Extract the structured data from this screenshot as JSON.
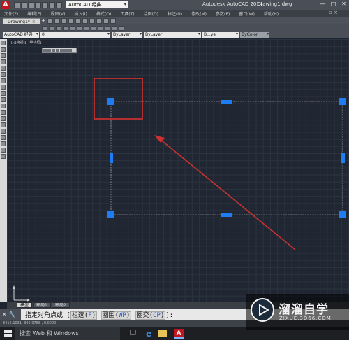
{
  "window": {
    "app_title": "Autodesk AutoCAD 2014",
    "document_title": "Drawing1.dwg",
    "workspace": "AutoCAD 经典",
    "controls": [
      "—",
      "□",
      "✕"
    ]
  },
  "menu": {
    "items": [
      "文件(F)",
      "编辑(E)",
      "视图(V)",
      "插入(I)",
      "格式(O)",
      "工具(T)",
      "绘图(D)",
      "标注(N)",
      "修改(M)",
      "参数(P)",
      "窗口(W)",
      "帮助(H)"
    ],
    "doc_controls": "_ ▫ ×"
  },
  "tabs": {
    "document": "Drawing1*",
    "close": "×",
    "add": "+"
  },
  "properties_toolbar": {
    "workspace": "AutoCAD 经典",
    "layer": "0",
    "color": "ByLayer",
    "linetype": "ByLayer",
    "lineweight": "B...ye",
    "plotstyle": "ByColor"
  },
  "viewport": {
    "label": "[-][俯视][二维线框]"
  },
  "layout_tabs": [
    "模型",
    "布局1",
    "布局2"
  ],
  "command": {
    "prompt": "指定对角点或 [",
    "options": [
      {
        "label": "栏选",
        "key": "F"
      },
      {
        "label": "圈围",
        "key": "WP"
      },
      {
        "label": "圈交",
        "key": "CP"
      }
    ],
    "suffix": "]:"
  },
  "status": {
    "coords": "3416.1031, 395.9788 , 0.0000"
  },
  "taskbar": {
    "search_placeholder": "搜索 Web 和 Windows"
  },
  "watermark": {
    "title": "溜溜自学",
    "url": "ZIXUE.3D66.COM"
  },
  "colors": {
    "grip": "#1e7df2",
    "highlight_box": "#d93030",
    "arrow": "#c83232",
    "canvas": "#212732"
  },
  "icons": {
    "app": "autocad-logo-icon",
    "ucs": "ucs-icon",
    "start": "windows-start-icon"
  }
}
